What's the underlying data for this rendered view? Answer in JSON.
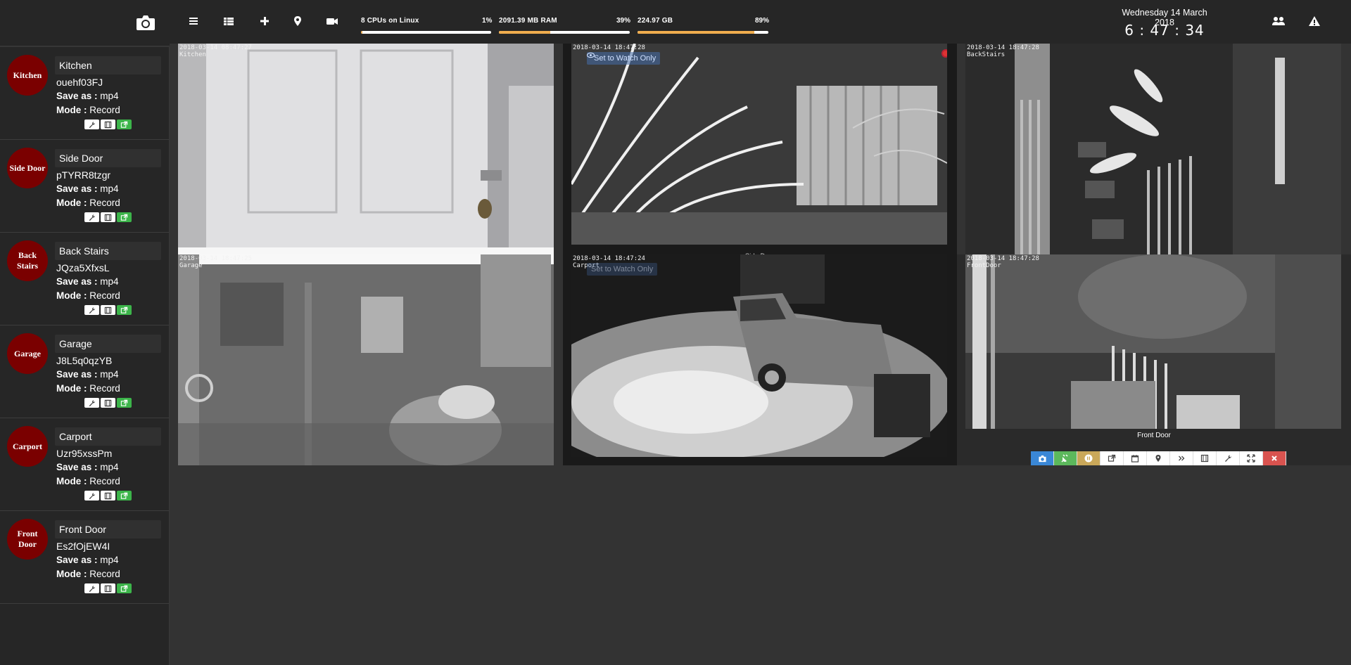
{
  "app": {
    "toolbar_icons": [
      "menu-icon",
      "grid-icon",
      "plus-icon",
      "map-marker-icon",
      "video-camera-icon"
    ],
    "right_icons": [
      "users-icon",
      "warning-icon"
    ]
  },
  "stats": {
    "cpu_label": "8 CPUs on Linux",
    "cpu_pct": "1%",
    "cpu_value": 1,
    "ram_label": "2091.39 MB RAM",
    "ram_pct": "39%",
    "ram_value": 39,
    "disk_label": "224.97 GB",
    "disk_pct": "89%",
    "disk_value": 89,
    "bar_color": "#f0ad4e"
  },
  "datetime": {
    "date": "Wednesday 14 March 2018",
    "time": "6 : 47 : 34"
  },
  "cameras": [
    {
      "avatar": "Kitchen",
      "name": "Kitchen",
      "id": "ouehf03FJ",
      "save_label": "Save as :",
      "save_value": " mp4",
      "mode_label": "Mode :",
      "mode_value": " Record"
    },
    {
      "avatar": "Side Door",
      "name": "Side Door",
      "id": "pTYRR8tzgr",
      "save_label": "Save as :",
      "save_value": " mp4",
      "mode_label": "Mode :",
      "mode_value": " Record"
    },
    {
      "avatar": "Back Stairs",
      "name": "Back Stairs",
      "id": "JQza5XfxsL",
      "save_label": "Save as :",
      "save_value": " mp4",
      "mode_label": "Mode :",
      "mode_value": " Record"
    },
    {
      "avatar": "Garage",
      "name": "Garage",
      "id": "J8L5q0qzYB",
      "save_label": "Save as :",
      "save_value": " mp4",
      "mode_label": "Mode :",
      "mode_value": " Record"
    },
    {
      "avatar": "Carport",
      "name": "Carport",
      "id": "Uzr95xssPm",
      "save_label": "Save as :",
      "save_value": " mp4",
      "mode_label": "Mode :",
      "mode_value": " Record"
    },
    {
      "avatar": "Front Door",
      "name": "Front Door",
      "id": "Es2fOjEW4I",
      "save_label": "Save as :",
      "save_value": " mp4",
      "mode_label": "Mode :",
      "mode_value": " Record"
    }
  ],
  "feeds": {
    "kitchen_ts": "2018-03-14 08:47:27\nKitchen",
    "sidedoor_ts": "2018-03-14 18:47:28",
    "backstairs_ts": "2018-03-14 18:47:28\nBackStairs",
    "garage_ts": "2018-03-14 18:47:25\nGarage",
    "carport_ts": "2018-03-14 18:47:24\nCarport",
    "frontdoor_ts": "2018-03-14 18:47:28\nFrontDoor",
    "watch_only": "Set to Watch Only",
    "sidedoor_caption": "Side Door",
    "frontdoor_caption": "Front Door"
  }
}
